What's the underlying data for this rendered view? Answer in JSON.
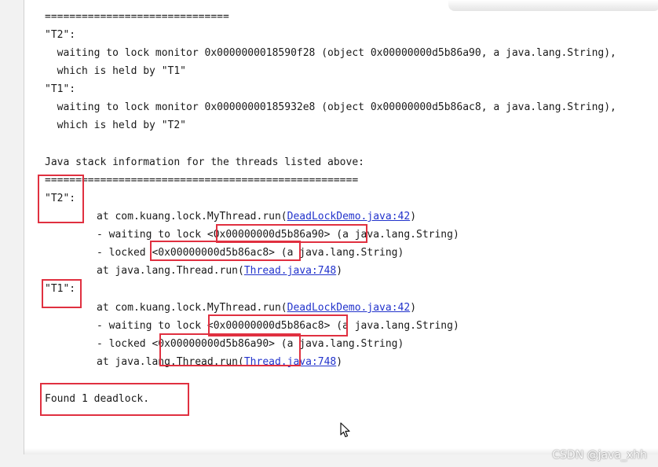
{
  "console": {
    "sep_short": "==============================",
    "t2_header": "\"T2\":",
    "t2_wait": "  waiting to lock monitor 0x0000000018590f28 (object 0x00000000d5b86a90, a java.lang.String),",
    "t2_held": "  which is held by \"T1\"",
    "t1_header": "\"T1\":",
    "t1_wait": "  waiting to lock monitor 0x00000000185932e8 (object 0x00000000d5b86ac8, a java.lang.String),",
    "t1_held": "  which is held by \"T2\"",
    "stack_title": "Java stack information for the threads listed above:",
    "sep_long": "===================================================",
    "stack_t2": {
      "name": "\"T2\":",
      "at_run_prefix": "at com.kuang.lock.MyThread.run(",
      "at_run_link": "DeadLockDemo.java:42",
      "at_run_suffix": ")",
      "waiting": "- waiting to lock <0x00000000d5b86a90> (a java.lang.String)",
      "locked": "- locked <0x00000000d5b86ac8> (a java.lang.String)",
      "at_thread_prefix": "at java.lang.Thread.run(",
      "at_thread_link": "Thread.java:748",
      "at_thread_suffix": ")"
    },
    "stack_t1": {
      "name": "\"T1\":",
      "at_run_prefix": "at com.kuang.lock.MyThread.run(",
      "at_run_link": "DeadLockDemo.java:42",
      "at_run_suffix": ")",
      "waiting": "- waiting to lock <0x00000000d5b86ac8> (a java.lang.String)",
      "locked": "- locked <0x00000000d5b86a90> (a java.lang.String)",
      "at_thread_prefix": "at java.lang.Thread.run(",
      "at_thread_link": "Thread.java:748",
      "at_thread_suffix": ")"
    },
    "found": "Found 1 deadlock."
  },
  "watermark": "CSDN @java_xhh",
  "colors": {
    "highlight": "#e03040",
    "link": "#2233cc",
    "text": "#1a1a1a"
  },
  "icons": {
    "cursor": "mouse-pointer-icon"
  }
}
